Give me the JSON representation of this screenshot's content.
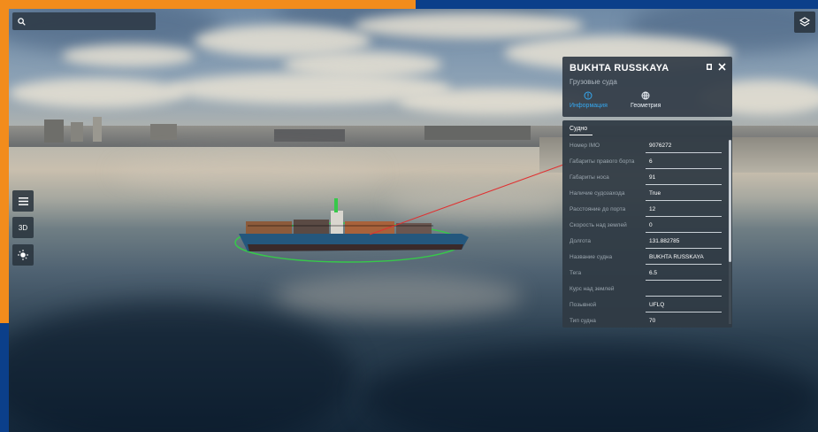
{
  "search": {
    "placeholder": ""
  },
  "side_controls": {
    "menu_icon": "hamburger-icon",
    "mode_label": "3D",
    "sun_icon": "sun-icon"
  },
  "top_right": {
    "layers_icon": "layers-icon"
  },
  "vessel_panel": {
    "title": "BUKHTA RUSSKAYA",
    "subtitle": "Грузовые суда",
    "tabs": [
      {
        "label": "Информация",
        "icon": "info-icon",
        "active": true
      },
      {
        "label": "Геометрия",
        "icon": "globe-icon",
        "active": false
      }
    ],
    "section_title": "Судно",
    "fields": [
      {
        "label": "Номер IMO",
        "value": "9076272"
      },
      {
        "label": "Габариты правого борта",
        "value": "6"
      },
      {
        "label": "Габариты носа",
        "value": "91"
      },
      {
        "label": "Наличие судозахода",
        "value": "True"
      },
      {
        "label": "Расстояние до порта",
        "value": "12"
      },
      {
        "label": "Скорость над землей",
        "value": "0"
      },
      {
        "label": "Долгота",
        "value": "131.882785"
      },
      {
        "label": "Название судна",
        "value": "BUKHTA RUSSKAYA"
      },
      {
        "label": "Тега",
        "value": "6.5"
      },
      {
        "label": "Курс над землей",
        "value": ""
      },
      {
        "label": "Позывной",
        "value": "UFLQ"
      },
      {
        "label": "Тип судна",
        "value": "70"
      }
    ]
  },
  "colors": {
    "accent": "#35a8f0",
    "frame_orange": "#f28c1c",
    "frame_blue": "#0b3f8a",
    "selection": "#37c84a",
    "pointer": "#e03030"
  }
}
